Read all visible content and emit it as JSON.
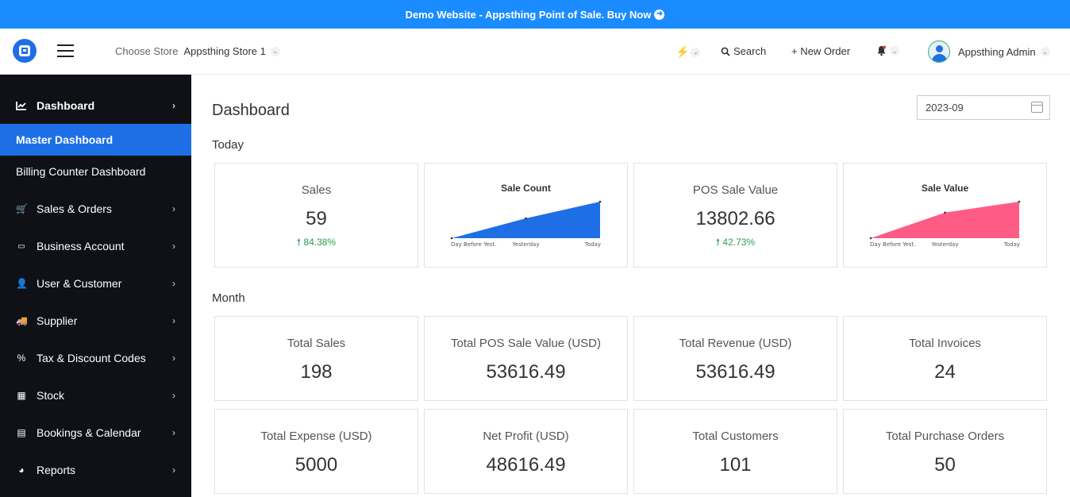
{
  "banner": {
    "text": "Demo Website - Appsthing Point of Sale. Buy Now",
    "icon": "arrow-circle-right-icon"
  },
  "header": {
    "store_label": "Choose Store",
    "store_name": "Appsthing Store 1",
    "search_label": "Search",
    "new_order_label": "+ New Order",
    "user_name": "Appsthing Admin"
  },
  "sidebar": {
    "items": [
      {
        "label": "Dashboard",
        "icon": "chart-line-icon"
      },
      {
        "label": "Master Dashboard"
      },
      {
        "label": "Billing Counter Dashboard"
      },
      {
        "label": "Sales & Orders",
        "icon": "cart-icon"
      },
      {
        "label": "Business Account",
        "icon": "money-icon"
      },
      {
        "label": "User & Customer",
        "icon": "user-icon"
      },
      {
        "label": "Supplier",
        "icon": "truck-icon"
      },
      {
        "label": "Tax & Discount Codes",
        "icon": "percent-icon"
      },
      {
        "label": "Stock",
        "icon": "boxes-icon"
      },
      {
        "label": "Bookings & Calendar",
        "icon": "calendar-icon"
      },
      {
        "label": "Reports",
        "icon": "pie-chart-icon"
      }
    ]
  },
  "main": {
    "title": "Dashboard",
    "date": "2023-09",
    "today_label": "Today",
    "month_label": "Month",
    "today_cards": [
      {
        "title": "Sales",
        "value": "59",
        "change": "84.38%"
      },
      {
        "title": "POS Sale Value",
        "value": "13802.66",
        "change": "42.73%"
      }
    ],
    "month_cards": [
      {
        "title": "Total Sales",
        "value": "198"
      },
      {
        "title": "Total POS Sale Value (USD)",
        "value": "53616.49"
      },
      {
        "title": "Total Revenue (USD)",
        "value": "53616.49"
      },
      {
        "title": "Total Invoices",
        "value": "24"
      },
      {
        "title": "Total Expense (USD)",
        "value": "5000"
      },
      {
        "title": "Net Profit (USD)",
        "value": "48616.49"
      },
      {
        "title": "Total Customers",
        "value": "101"
      },
      {
        "title": "Total Purchase Orders",
        "value": "50"
      }
    ]
  },
  "chart_data": [
    {
      "type": "area",
      "title": "Sale Count",
      "categories": [
        "Day Before Yest.",
        "Yesterday",
        "Today"
      ],
      "values": [
        0,
        32,
        59
      ],
      "color": "#1e6fe6"
    },
    {
      "type": "area",
      "title": "Sale Value",
      "categories": [
        "Day Before Yest.",
        "Yesterday",
        "Today"
      ],
      "values": [
        0,
        9669,
        13802.66
      ],
      "color": "#ff5c85"
    }
  ]
}
